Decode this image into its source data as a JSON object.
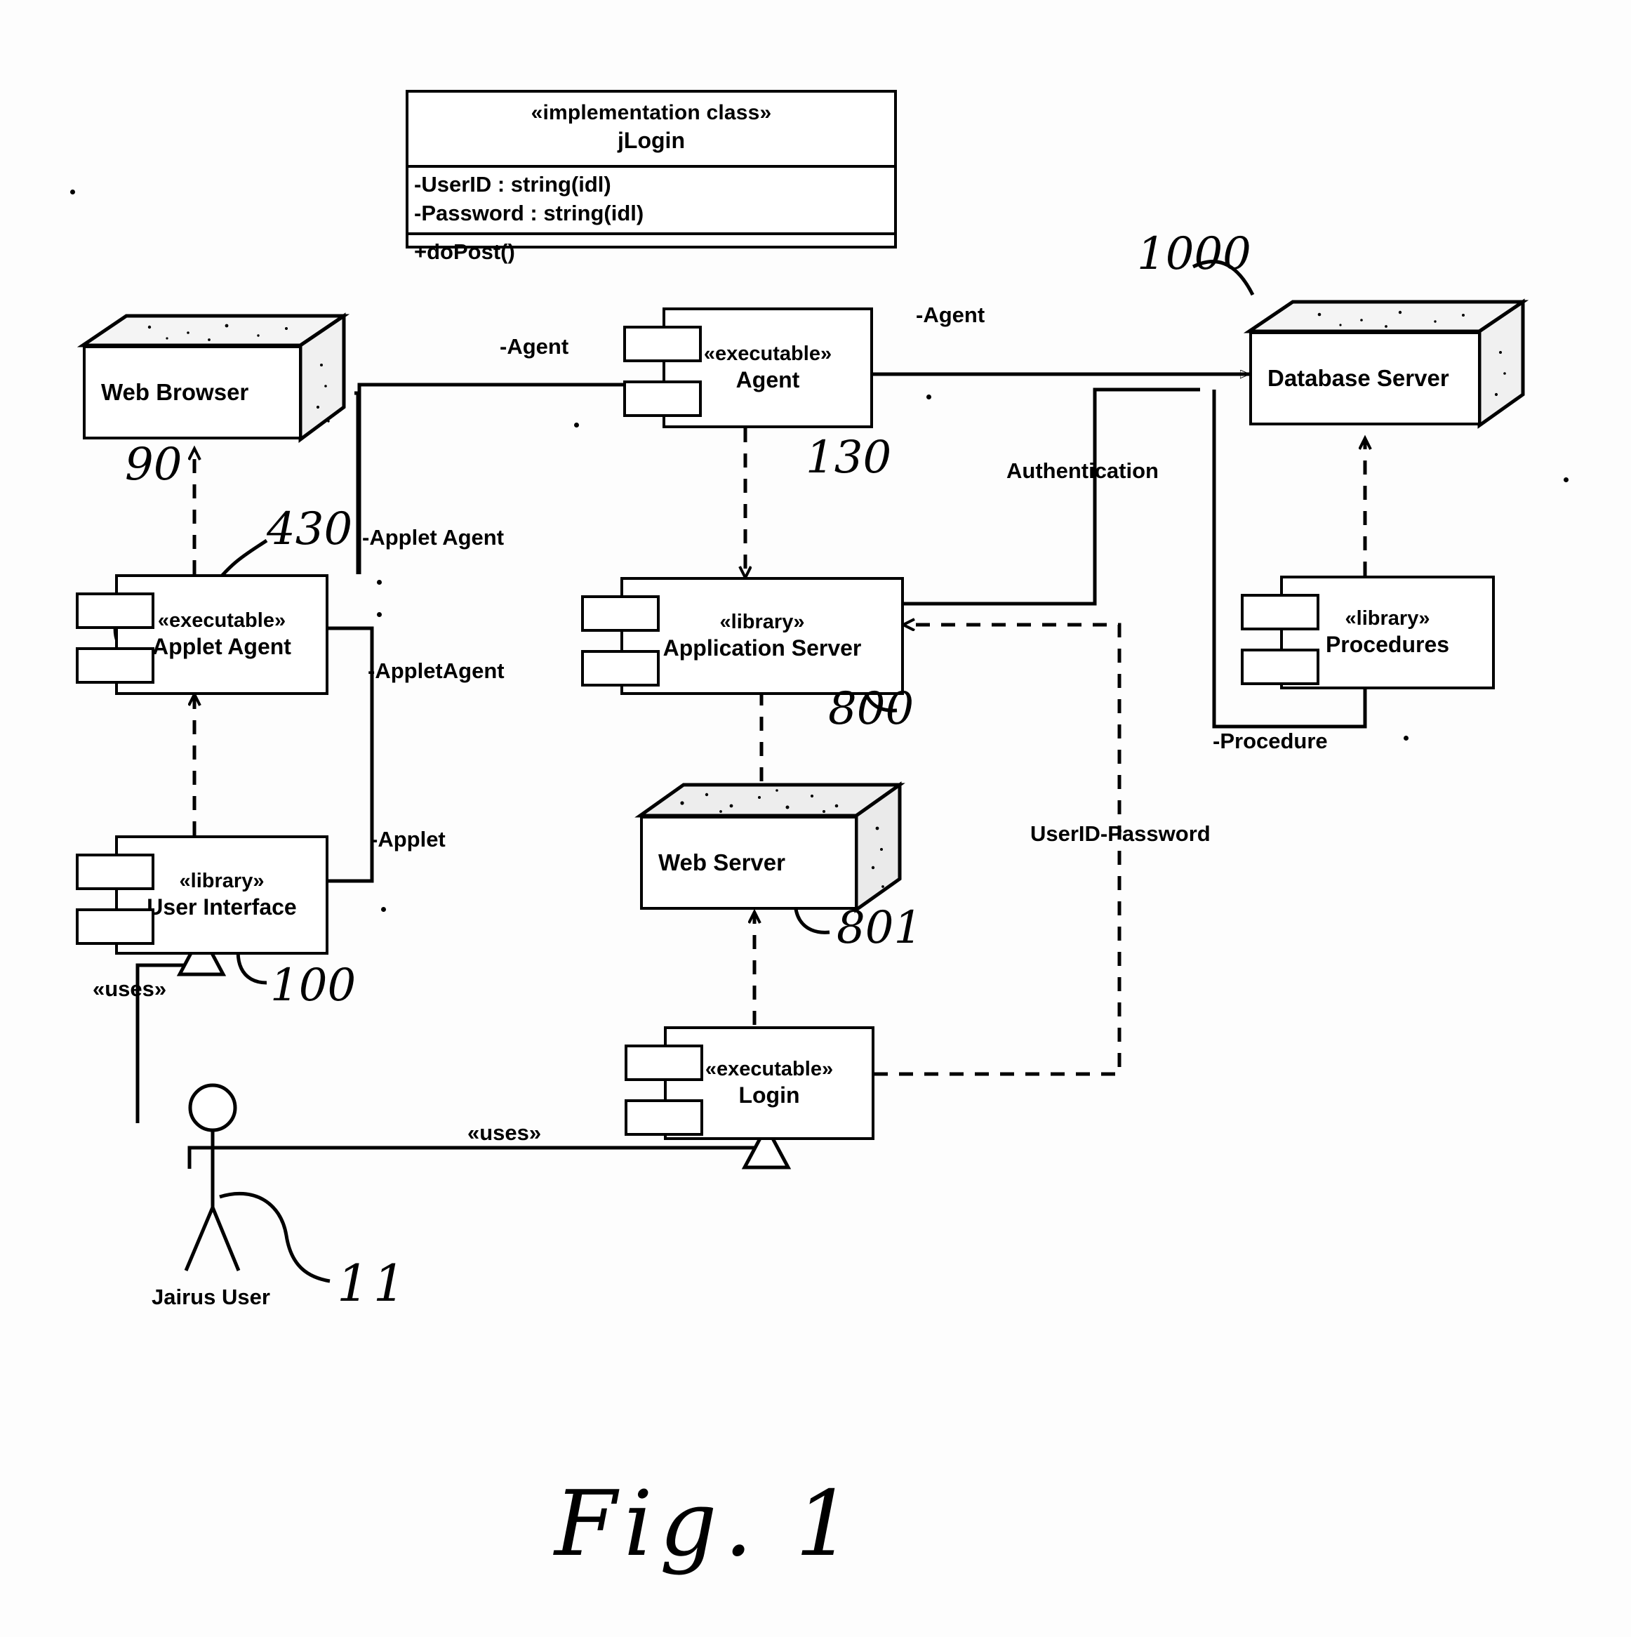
{
  "figure": {
    "caption": "Fig. 1",
    "actor_name": "Jairus User"
  },
  "class_box": {
    "stereotype": "«implementation class»",
    "name": "jLogin",
    "attributes": [
      "-UserID : string(idl)",
      "-Password : string(idl)"
    ],
    "operations": [
      "+doPost()"
    ]
  },
  "nodes": [
    {
      "id": "web-browser",
      "label": "Web Browser",
      "ref": "90"
    },
    {
      "id": "database-server",
      "label": "Database Server",
      "ref": "1000"
    },
    {
      "id": "web-server",
      "label": "Web Server",
      "ref": "801"
    }
  ],
  "components": [
    {
      "id": "applet-agent",
      "stereotype": "«executable»",
      "name": "Applet Agent",
      "ref": "430"
    },
    {
      "id": "user-interface",
      "stereotype": "«library»",
      "name": "User Interface",
      "ref": "100"
    },
    {
      "id": "agent",
      "stereotype": "«executable»",
      "name": "Agent",
      "ref": "130"
    },
    {
      "id": "application-server",
      "stereotype": "«library»",
      "name": "Application Server",
      "ref": "800"
    },
    {
      "id": "login",
      "stereotype": "«executable»",
      "name": "Login",
      "ref": ""
    },
    {
      "id": "procedures",
      "stereotype": "«library»",
      "name": "Procedures",
      "ref": ""
    }
  ],
  "connector_labels": {
    "agent_left": "-Agent",
    "agent_right": "-Agent",
    "applet_agent_spaced": "-Applet Agent",
    "applet_agent_joined": "-AppletAgent",
    "applet": "-Applet",
    "authentication": "Authentication",
    "userid_password": "UserID-Password",
    "procedure": "-Procedure",
    "uses_left": "«uses»",
    "uses_bottom": "«uses»"
  },
  "annotations": {
    "ref_90": "90",
    "ref_430": "430",
    "ref_100": "100",
    "ref_130": "130",
    "ref_800": "800",
    "ref_801": "801",
    "ref_1000": "1000",
    "ref_11": "11"
  },
  "colors": {
    "ink": "#000000",
    "paper": "#fdfdfd"
  }
}
